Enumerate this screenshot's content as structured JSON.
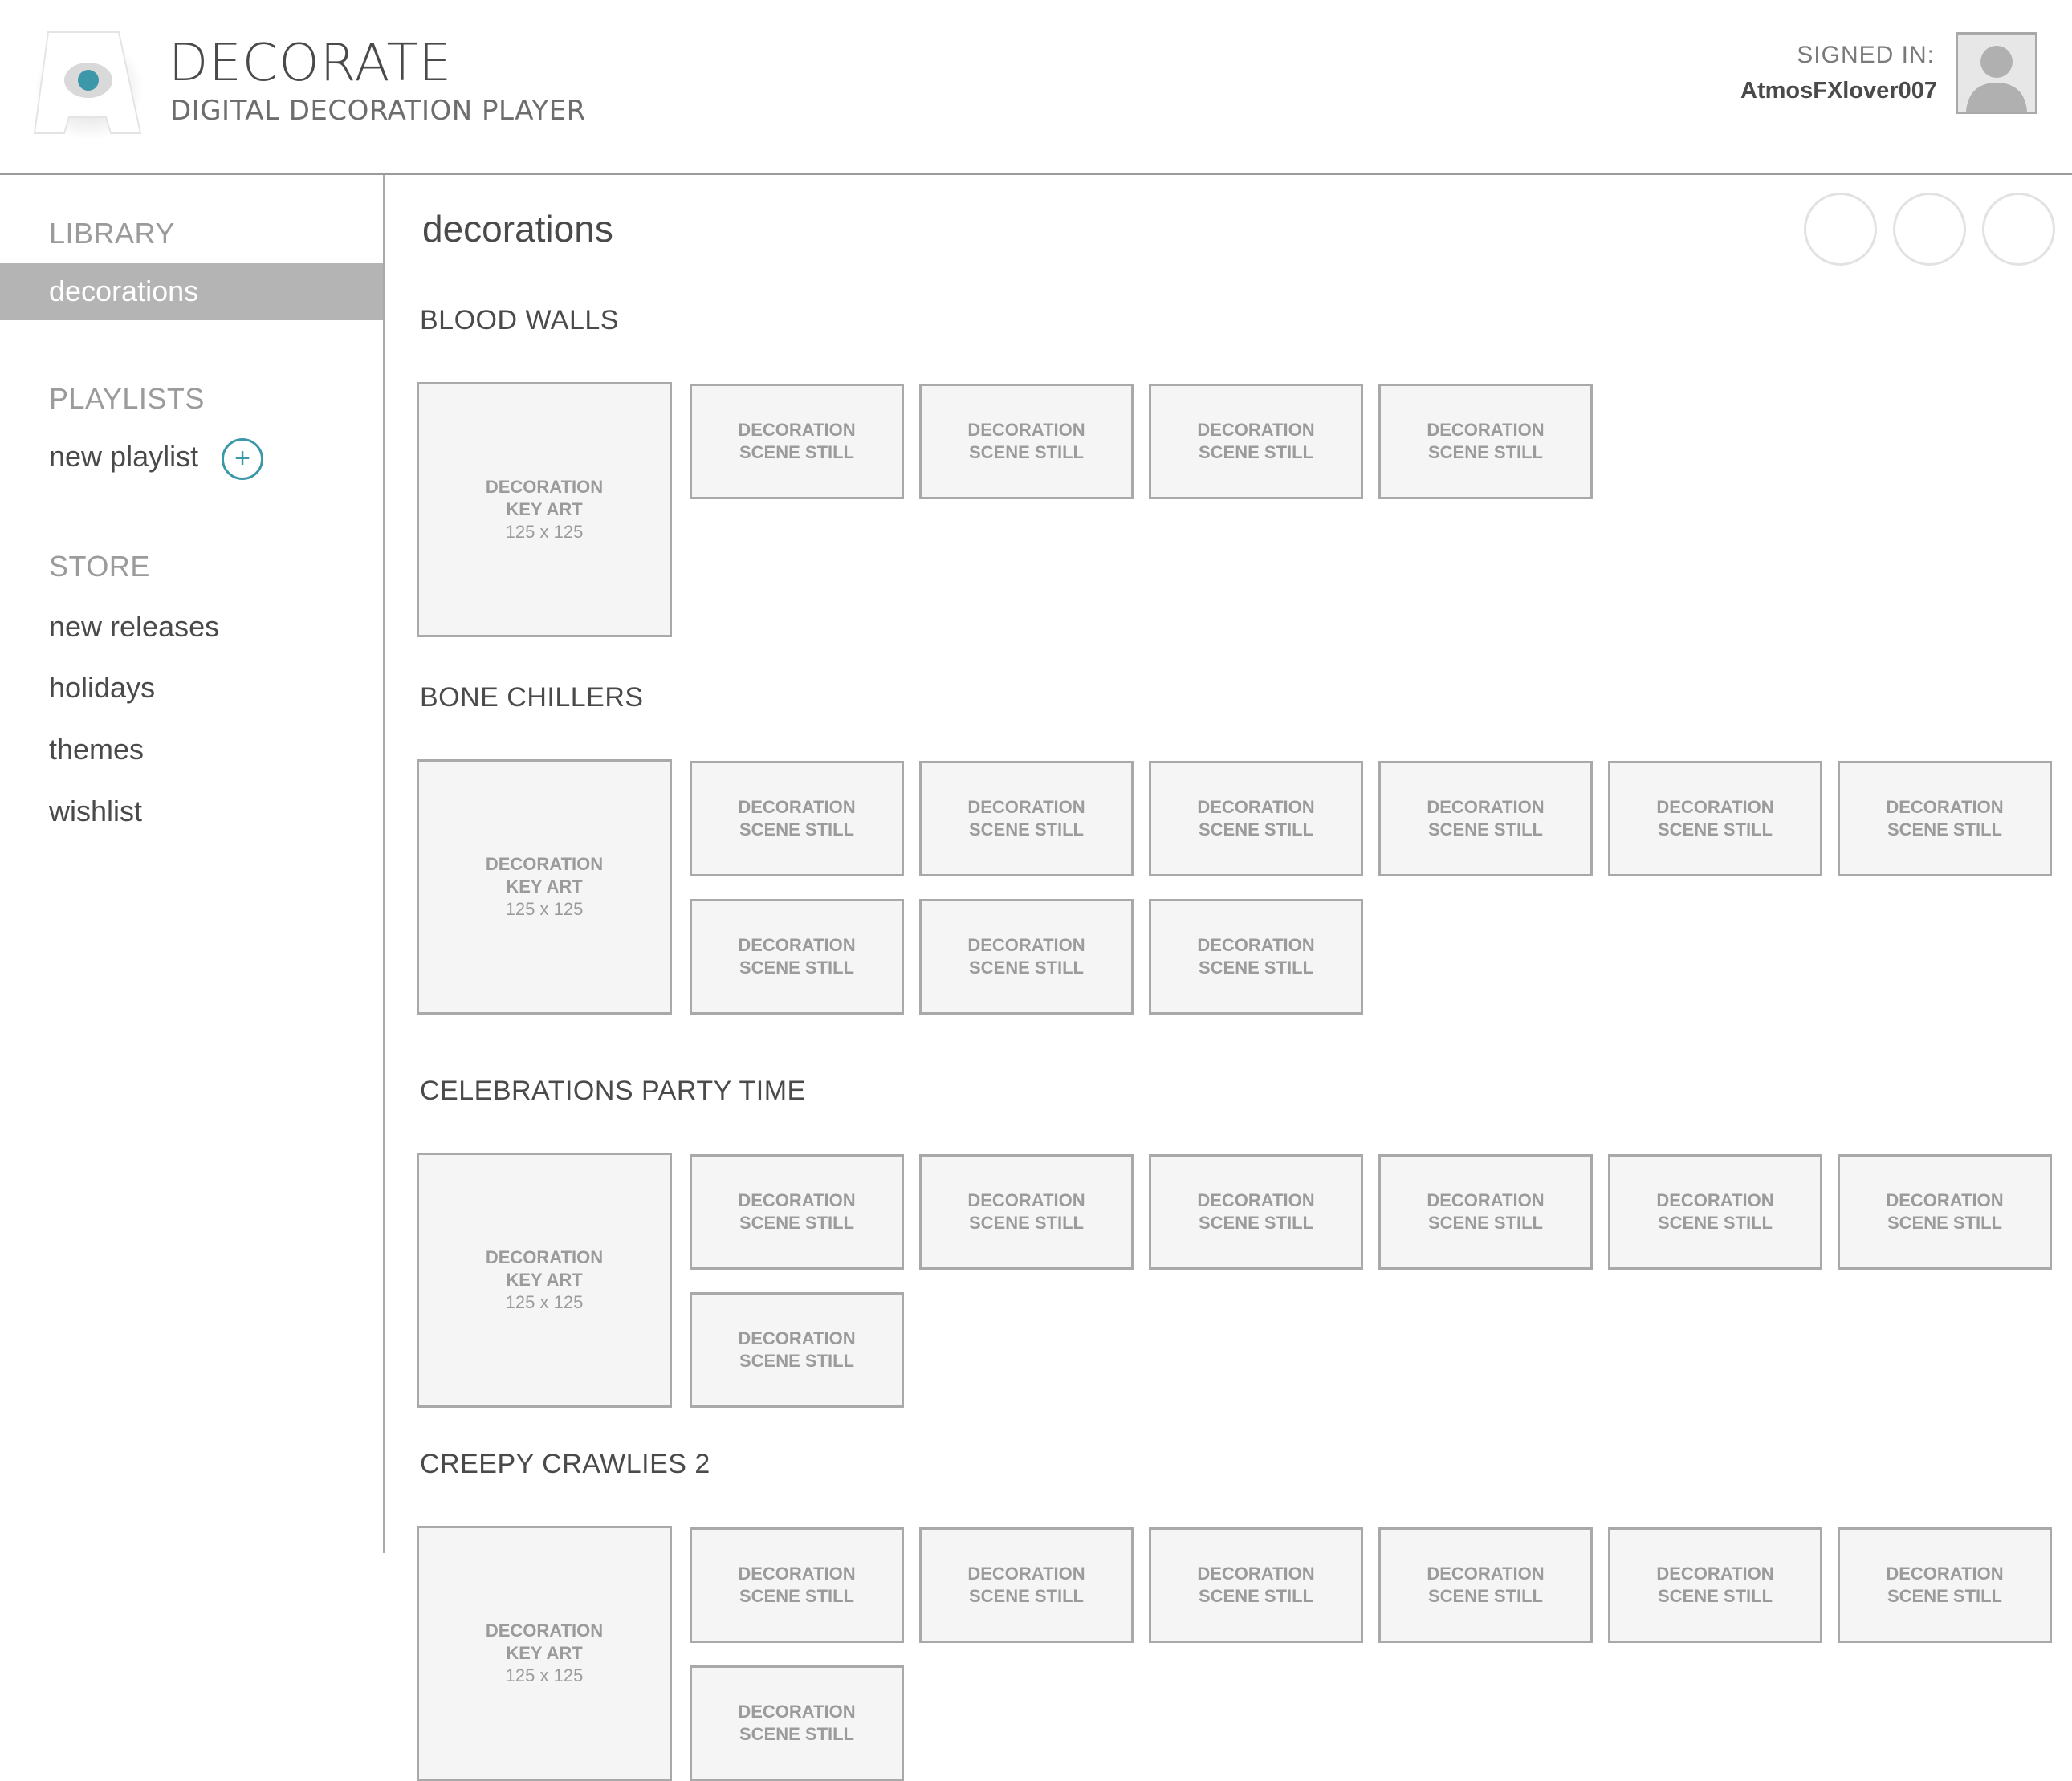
{
  "header": {
    "app_title": "DECORATE",
    "app_subtitle": "DIGITAL DECORATION PLAYER",
    "signed_in_label": "SIGNED IN:",
    "username": "AtmosFXlover007",
    "logo_icon": "eye-logo-icon",
    "accent_color": "#3c97a8"
  },
  "sidebar": {
    "library_heading": "LIBRARY",
    "library_items": [
      "decorations"
    ],
    "playlists_heading": "PLAYLISTS",
    "new_playlist_label": "new playlist",
    "add_symbol": "+",
    "store_heading": "STORE",
    "store_items": [
      "new releases",
      "holidays",
      "themes",
      "wishlist"
    ]
  },
  "main": {
    "page_title": "decorations",
    "keyart_line1": "DECORATION",
    "keyart_line2": "KEY ART",
    "keyart_line3": "125 x 125",
    "still_label": "DECORATION\nSCENE STILL",
    "categories": [
      {
        "title": "BLOOD WALLS",
        "still_count": 4
      },
      {
        "title": "BONE CHILLERS",
        "still_count": 9
      },
      {
        "title": "CELEBRATIONS PARTY TIME",
        "still_count": 7
      },
      {
        "title": "CREEPY CRAWLIES 2",
        "still_count": 7
      }
    ]
  }
}
